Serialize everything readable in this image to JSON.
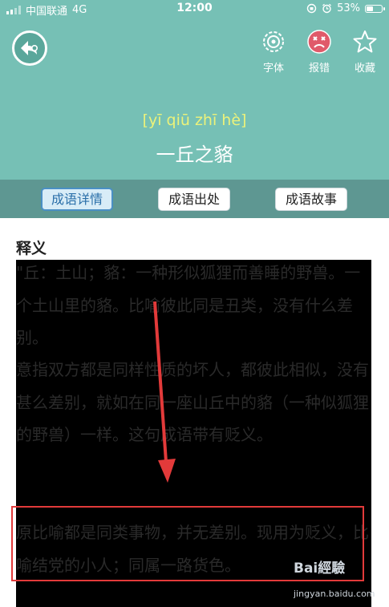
{
  "status": {
    "carrier": "中国联通",
    "network": "4G",
    "time": "12:00",
    "battery": "53%",
    "battery_level": 0.53
  },
  "header": {
    "back_icon": "back-arrow-icon",
    "tools": [
      {
        "label": "字体",
        "icon": "font-gear-icon"
      },
      {
        "label": "报错",
        "icon": "error-report-icon",
        "color": "#e05a6a"
      },
      {
        "label": "收藏",
        "icon": "star-icon"
      }
    ],
    "pinyin": "[yī qiū zhī hè]",
    "idiom": "一丘之貉"
  },
  "tabs": [
    {
      "label": "成语详情",
      "active": true
    },
    {
      "label": "成语出处",
      "active": false
    },
    {
      "label": "成语故事",
      "active": false
    }
  ],
  "content": {
    "section_title": "释义",
    "paragraph1": "\"丘：土山；貉：一种形似狐狸而善睡的野兽。一个土山里的貉。比喻彼此同是丑类，没有什么差别。",
    "paragraph2": "意指双方都是同样性质的坏人，都彼此相似，没有甚么差别，就如在同一座山丘中的貉（一种似狐狸的野兽）一样。这句成语带有贬义。",
    "paragraph3": "原比喻都是同类事物，并无差别。现用为贬义，比喻结党的小人；同属一路货色。"
  },
  "watermark": {
    "logo": "Bai經驗",
    "url": "jingyan.baidu.com"
  },
  "colors": {
    "header_bg": "#76c0b5",
    "tabbar_bg": "#5e9792",
    "pinyin": "#ecf27a",
    "highlight": "#e23a3a"
  }
}
